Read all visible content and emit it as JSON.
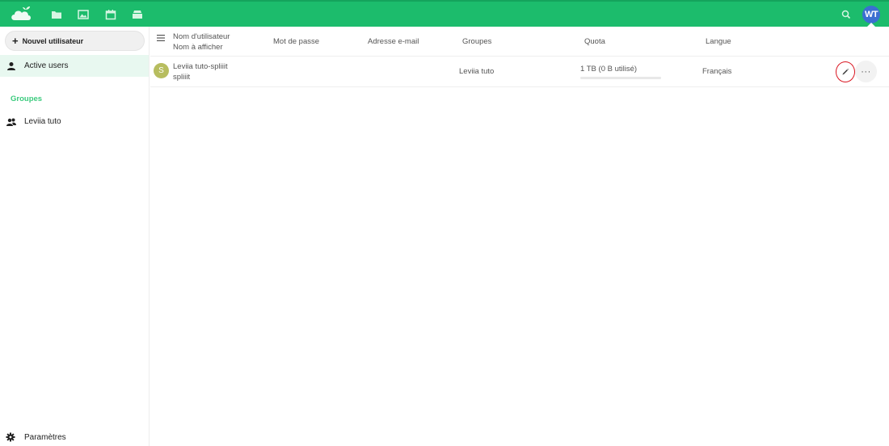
{
  "topbar": {
    "brand_color": "#1cbc6c",
    "apps": [
      {
        "name": "files",
        "icon": "folder-icon"
      },
      {
        "name": "photos",
        "icon": "image-icon"
      },
      {
        "name": "calendar",
        "icon": "calendar-icon"
      },
      {
        "name": "deck",
        "icon": "stack-icon"
      }
    ],
    "user_initials": "WT",
    "user_avatar_color": "#3b6fd1"
  },
  "sidebar": {
    "new_user_label": "Nouvel utilisateur",
    "active_users_label": "Active users",
    "groups_caption": "Groupes",
    "groups": [
      {
        "label": "Leviia tuto"
      }
    ],
    "settings_label": "Paramètres"
  },
  "table": {
    "headers": {
      "username": "Nom d'utilisateur",
      "display_name": "Nom à afficher",
      "password": "Mot de passe",
      "email": "Adresse e-mail",
      "groups": "Groupes",
      "quota": "Quota",
      "language": "Langue"
    },
    "rows": [
      {
        "avatar_initial": "S",
        "avatar_color": "#b7bd5f",
        "username": "Leviia tuto-spliiit",
        "display_name": "spliiit",
        "password": "",
        "email": "",
        "groups": "Leviia tuto",
        "quota": "1 TB (0 B utilisé)",
        "quota_used_fraction": 0,
        "language": "Français",
        "more_label": "···"
      }
    ]
  }
}
